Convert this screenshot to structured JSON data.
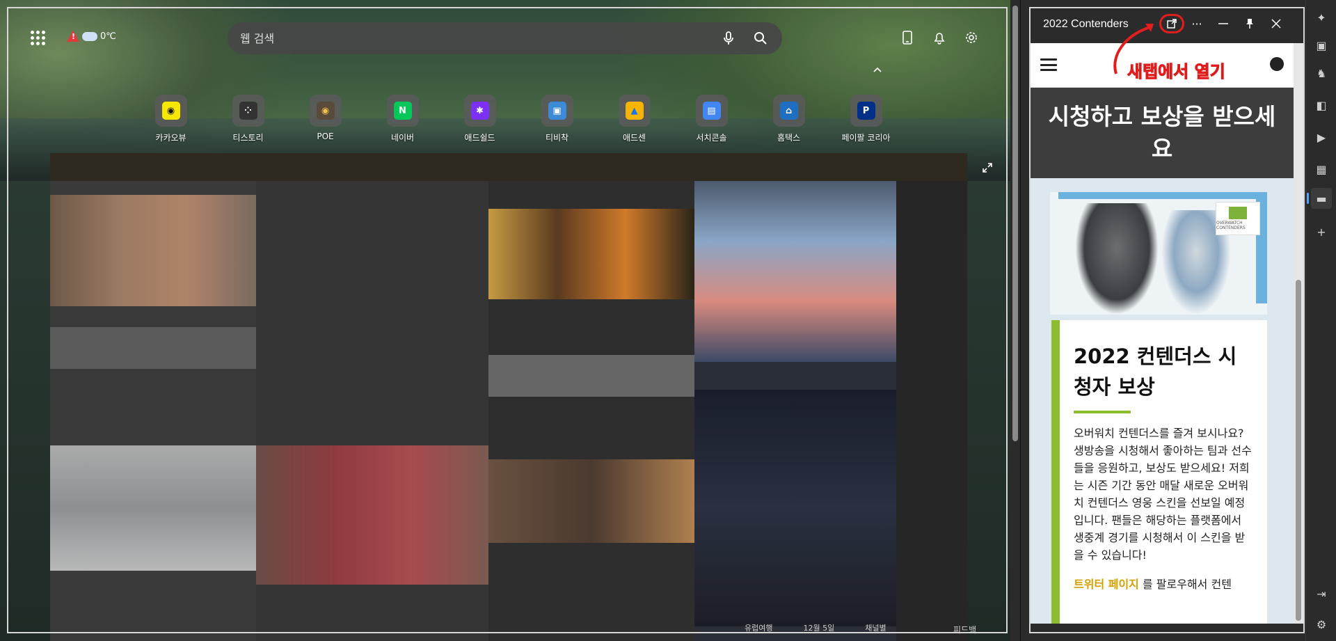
{
  "weather": {
    "temperature": "0℃"
  },
  "search": {
    "placeholder": "웹 검색"
  },
  "quicklinks": [
    {
      "label": "카카오뷰",
      "color": "#f7e600",
      "glyph": "◉"
    },
    {
      "label": "티스토리",
      "color": "#333333",
      "glyph": "⁘"
    },
    {
      "label": "POE",
      "color": "#5a4a3a",
      "glyph": "◉"
    },
    {
      "label": "네이버",
      "color": "#03c75a",
      "glyph": "N"
    },
    {
      "label": "애드쉴드",
      "color": "#7b2ff7",
      "glyph": "✱"
    },
    {
      "label": "티비착",
      "color": "#3d8bd7",
      "glyph": "▣"
    },
    {
      "label": "애드센",
      "color": "#f4b400",
      "glyph": "▲"
    },
    {
      "label": "서치콘솔",
      "color": "#4285f4",
      "glyph": "▤"
    },
    {
      "label": "홈택스",
      "color": "#1e6fc4",
      "glyph": "⌂"
    },
    {
      "label": "페이팔 코리아",
      "color": "#003087",
      "glyph": "P"
    }
  ],
  "feed_footer": {
    "items": [
      "유럽여행",
      "12월 5일",
      "채널별"
    ],
    "feedback": "피드백"
  },
  "pane": {
    "title": "2022 Contenders",
    "hero_title": "시청하고 보상을 받으세요",
    "banner_logo_text": "OVERWATCH CONTENDERS",
    "card_heading": "2022 컨텐더스 시청자 보상",
    "card_text": "오버워치 컨텐더스를 즐겨 보시나요? 생방송을 시청해서 좋아하는 팀과 선수들을 응원하고, 보상도 받으세요! 저희는 시즌 기간 동안 매달 새로운 오버워치 컨텐더스 영웅 스킨을 선보일 예정입니다. 팬들은 해당하는 플랫폼에서 생중계 경기를 시청해서 이 스킨을 받을 수 있습니다!",
    "card_link": "트위터 페이지",
    "card_link_suffix": "를 팔로우해서 컨텐"
  },
  "callout": {
    "text": "새탭에서 열기",
    "color": "#e01e1e"
  },
  "colors": {
    "accent": "#8bbd2e",
    "hero_bg": "#3d3d3d",
    "link": "#d4a000"
  }
}
